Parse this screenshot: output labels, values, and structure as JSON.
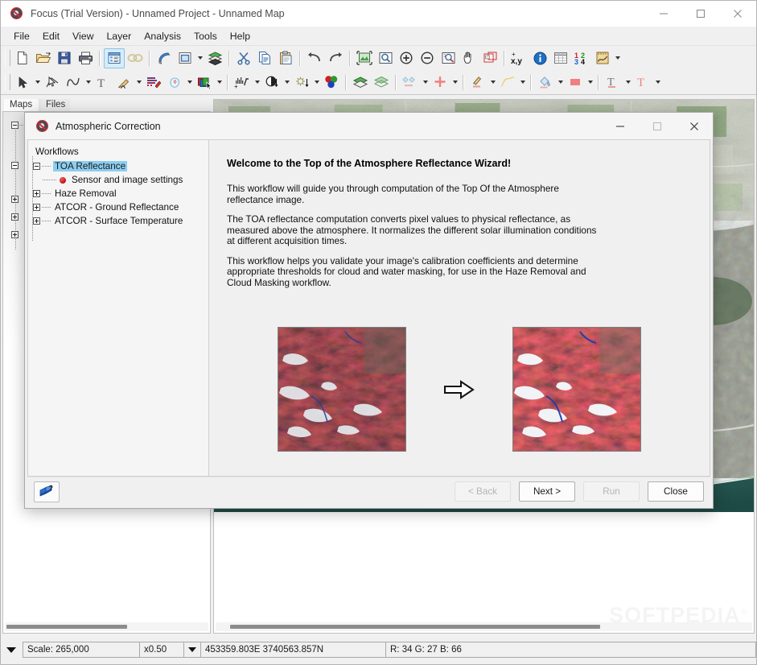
{
  "window": {
    "title": "Focus (Trial Version) - Unnamed Project - Unnamed Map",
    "icon": "eye-icon",
    "minimize": "—",
    "maximize": "☐",
    "close": "✕"
  },
  "menubar": {
    "items": [
      {
        "label": "File"
      },
      {
        "label": "Edit"
      },
      {
        "label": "View"
      },
      {
        "label": "Layer"
      },
      {
        "label": "Analysis"
      },
      {
        "label": "Tools"
      },
      {
        "label": "Help"
      }
    ]
  },
  "toolbars": {
    "row1": [
      {
        "icon": "new-file-icon",
        "type": "button"
      },
      {
        "icon": "open-folder-icon",
        "type": "button"
      },
      {
        "icon": "save-floppy-icon",
        "type": "button"
      },
      {
        "icon": "print-icon",
        "type": "button"
      },
      {
        "sep": true
      },
      {
        "icon": "layer-properties-icon",
        "type": "button",
        "active": true
      },
      {
        "icon": "link-chain-icon",
        "type": "button",
        "disabled": true
      },
      {
        "sep": true
      },
      {
        "icon": "blend-roller-icon",
        "type": "button"
      },
      {
        "icon": "window-view-icon",
        "type": "button"
      },
      {
        "icon": "dropdown-arrow",
        "type": "arrow"
      },
      {
        "icon": "layers-stack-icon",
        "type": "button"
      },
      {
        "sep": true
      },
      {
        "icon": "cut-scissors-icon",
        "type": "button"
      },
      {
        "icon": "copy-icon",
        "type": "button"
      },
      {
        "icon": "paste-clipboard-icon",
        "type": "button"
      },
      {
        "divider": true
      },
      {
        "icon": "undo-arrow-icon",
        "type": "button"
      },
      {
        "icon": "redo-arrow-icon",
        "type": "button"
      },
      {
        "sep": true
      },
      {
        "icon": "fit-image-icon",
        "type": "button"
      },
      {
        "icon": "zoom-magnifier-icon",
        "type": "button"
      },
      {
        "icon": "zoom-in-icon",
        "type": "button"
      },
      {
        "icon": "zoom-out-icon",
        "type": "button"
      },
      {
        "icon": "zoom-one-to-one-icon",
        "type": "button"
      },
      {
        "icon": "pan-hand-icon",
        "type": "button"
      },
      {
        "icon": "overview-window-icon",
        "type": "button"
      },
      {
        "sep": true
      },
      {
        "icon": "coordinate-xy-icon",
        "type": "button"
      },
      {
        "icon": "info-icon",
        "type": "button"
      },
      {
        "icon": "table-grid-icon",
        "type": "button"
      },
      {
        "icon": "numbers-1234-icon",
        "type": "button"
      },
      {
        "icon": "measure-ruler-icon",
        "type": "button"
      },
      {
        "icon": "dropdown-arrow",
        "type": "arrow"
      }
    ],
    "row2": [
      {
        "icon": "select-arrow-icon",
        "type": "button"
      },
      {
        "icon": "dropdown-arrow",
        "type": "arrow"
      },
      {
        "icon": "vertex-edit-icon",
        "type": "button"
      },
      {
        "icon": "polyline-icon",
        "type": "button"
      },
      {
        "icon": "dropdown-arrow",
        "type": "arrow"
      },
      {
        "icon": "text-tool-icon",
        "type": "button"
      },
      {
        "icon": "measure-pencil-icon",
        "type": "button"
      },
      {
        "icon": "dropdown-arrow",
        "type": "arrow"
      },
      {
        "icon": "raster-edit-icon",
        "type": "button"
      },
      {
        "icon": "shape-region-icon",
        "type": "button"
      },
      {
        "icon": "dropdown-arrow",
        "type": "arrow"
      },
      {
        "icon": "layer-select-icon",
        "type": "button"
      },
      {
        "icon": "dropdown-arrow",
        "type": "arrow"
      },
      {
        "sep": true
      },
      {
        "icon": "histogram-enhance-icon",
        "type": "button"
      },
      {
        "icon": "dropdown-arrow",
        "type": "arrow"
      },
      {
        "icon": "contrast-icon",
        "type": "button"
      },
      {
        "icon": "dropdown-arrow",
        "type": "arrow"
      },
      {
        "icon": "brightness-icon",
        "type": "button"
      },
      {
        "icon": "dropdown-arrow",
        "type": "arrow"
      },
      {
        "icon": "rgb-balls-icon",
        "type": "button"
      },
      {
        "sep": true
      },
      {
        "icon": "map-layer-icon",
        "type": "button"
      },
      {
        "icon": "vector-layer-icon",
        "type": "button"
      },
      {
        "sep": true
      },
      {
        "icon": "symbol-style-icon",
        "type": "button"
      },
      {
        "icon": "dropdown-arrow",
        "type": "arrow"
      },
      {
        "icon": "point-cross-icon",
        "type": "button"
      },
      {
        "icon": "dropdown-arrow",
        "type": "arrow"
      },
      {
        "divider": true
      },
      {
        "icon": "line-style-brush-icon",
        "type": "button"
      },
      {
        "icon": "dropdown-arrow",
        "type": "arrow"
      },
      {
        "icon": "curve-line-icon",
        "type": "button"
      },
      {
        "icon": "dropdown-arrow",
        "type": "arrow"
      },
      {
        "divider": true
      },
      {
        "icon": "fill-bucket-icon",
        "type": "button"
      },
      {
        "icon": "dropdown-arrow",
        "type": "arrow"
      },
      {
        "icon": "fill-color-swatch-icon",
        "type": "button"
      },
      {
        "icon": "dropdown-arrow",
        "type": "arrow"
      },
      {
        "divider": true
      },
      {
        "icon": "text-style-icon",
        "type": "button"
      },
      {
        "icon": "dropdown-arrow",
        "type": "arrow"
      },
      {
        "icon": "text-color-icon",
        "type": "button"
      },
      {
        "icon": "dropdown-arrow",
        "type": "arrow"
      }
    ]
  },
  "panels": {
    "tabs": [
      {
        "label": "Maps",
        "selected": true
      },
      {
        "label": "Files",
        "selected": false
      }
    ]
  },
  "dialog": {
    "title": "Atmospheric Correction",
    "icon": "eye-icon",
    "minimize": "—",
    "maximize": "☐",
    "close": "✕",
    "tree": {
      "root_label": "Workflows",
      "nodes": [
        {
          "label": "TOA Reflectance",
          "expander": "minus",
          "selected": true,
          "level": 0
        },
        {
          "label": "Sensor and image settings",
          "expander": "none",
          "bullet": "red-dot",
          "level": 1
        },
        {
          "label": "Haze Removal",
          "expander": "plus",
          "level": 0
        },
        {
          "label": "ATCOR - Ground Reflectance",
          "expander": "plus",
          "level": 0
        },
        {
          "label": "ATCOR - Surface Temperature",
          "expander": "plus",
          "level": 0
        }
      ]
    },
    "content": {
      "heading": "Welcome to the Top of the Atmosphere Reflectance Wizard!",
      "paragraphs": [
        "This workflow will guide you through computation of the Top Of the Atmosphere reflectance image.",
        "The TOA reflectance computation converts pixel values to physical reflectance, as measured above the atmosphere. It normalizes the different solar illumination conditions at different acquisition times.",
        "This workflow helps you validate your image's calibration coefficients and determine appropriate thresholds for cloud and water masking, for use in the Haze Removal and Cloud Masking workflow."
      ],
      "image_before_name": "satellite-image-before",
      "image_after_name": "satellite-image-after",
      "arrow_name": "arrow-right-icon"
    },
    "footer": {
      "help_icon": "help-book-icon",
      "buttons": [
        {
          "label": "< Back",
          "disabled": true,
          "name": "back-button"
        },
        {
          "label": "Next >",
          "disabled": false,
          "name": "next-button"
        },
        {
          "label": "Run",
          "disabled": true,
          "name": "run-button"
        },
        {
          "label": "Close",
          "disabled": false,
          "name": "close-button"
        }
      ]
    }
  },
  "statusbar": {
    "scale": "Scale: 265,000",
    "zoom": "x0.50",
    "coordinates": "453359.803E 3740563.857N",
    "rgb": "R: 34 G: 27 B: 66"
  },
  "watermark": {
    "text": "SOFTPEDIA",
    "mark": "®"
  },
  "colors": {
    "selection_blue": "#8ccdf0",
    "toolbar_active": "#d6ecfb",
    "window_bg": "#f0f0f0",
    "panel_bg": "#ffffff",
    "red_accent": "#c01010"
  }
}
